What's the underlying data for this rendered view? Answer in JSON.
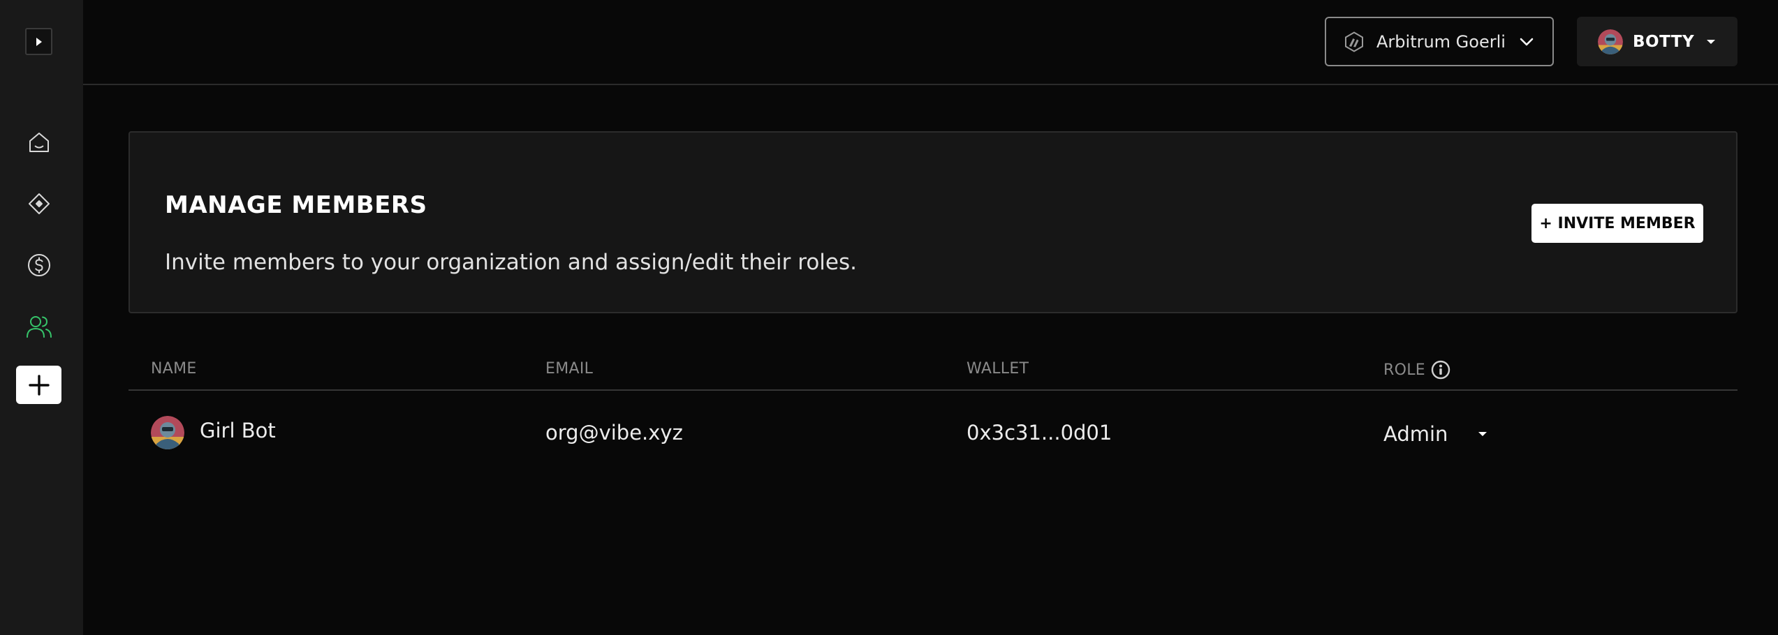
{
  "sidebar": {
    "items": [
      {
        "name": "home",
        "icon": "home-icon",
        "active": false
      },
      {
        "name": "projects",
        "icon": "diamond-icon",
        "active": false
      },
      {
        "name": "billing",
        "icon": "dollar-circle-icon",
        "active": false
      },
      {
        "name": "members",
        "icon": "users-icon",
        "active": true
      }
    ],
    "add_icon": "plus-icon",
    "expand_icon": "play-right-icon"
  },
  "header": {
    "network": {
      "label": "Arbitrum Goerli",
      "icon": "arbitrum-logo-icon",
      "chevron": "chevron-down-icon"
    },
    "account": {
      "label": "BOTTY",
      "icon": "avatar",
      "caret": "caret-down-icon"
    }
  },
  "card": {
    "title": "MANAGE MEMBERS",
    "description": "Invite members to your organization and assign/edit their roles.",
    "invite_label": "+ INVITE MEMBER"
  },
  "table": {
    "columns": {
      "name": "NAME",
      "email": "EMAIL",
      "wallet": "WALLET",
      "role": "ROLE"
    },
    "rows": [
      {
        "name": "Girl Bot",
        "email": "org@vibe.xyz",
        "wallet": "0x3c31...0d01",
        "role": "Admin"
      }
    ]
  },
  "colors": {
    "background": "#080808",
    "sidebar": "#191919",
    "accent_green": "#36c46a",
    "card": "#161616"
  }
}
